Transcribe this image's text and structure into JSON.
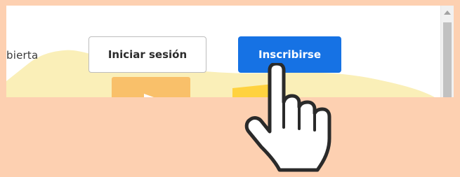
{
  "page": {
    "partial_text": "bierta"
  },
  "buttons": {
    "login_label": "Iniciar sesión",
    "signup_label": "Inscribirse"
  },
  "icons": {
    "cursor": "pointing-hand-cursor-icon",
    "scroll_up": "triangle-up-icon",
    "media_play": "play-icon"
  },
  "colors": {
    "backdrop": "#FDD0B1",
    "signup_button": "#1672E4",
    "hero_blob": "#FAEFB8",
    "orange_card": "#F9C06A",
    "yellow_card": "#FFD23F"
  }
}
